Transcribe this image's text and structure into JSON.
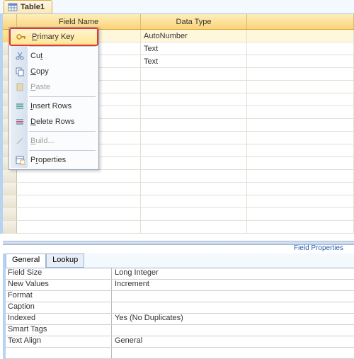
{
  "tab": {
    "label": "Table1"
  },
  "columns": {
    "fieldname": "Field Name",
    "datatype": "Data Type"
  },
  "rows": [
    {
      "datatype": "AutoNumber"
    },
    {
      "datatype": "Text"
    },
    {
      "datatype": "Text"
    }
  ],
  "menu": {
    "primary_key": "Primary Key",
    "cut": "Cut",
    "copy": "Copy",
    "paste": "Paste",
    "insert_rows": "Insert Rows",
    "delete_rows": "Delete Rows",
    "build": "Build...",
    "properties": "Properties"
  },
  "field_properties_label": "Field Properties",
  "props_tabs": {
    "general": "General",
    "lookup": "Lookup"
  },
  "properties": [
    {
      "name": "Field Size",
      "value": "Long Integer"
    },
    {
      "name": "New Values",
      "value": "Increment"
    },
    {
      "name": "Format",
      "value": ""
    },
    {
      "name": "Caption",
      "value": ""
    },
    {
      "name": "Indexed",
      "value": "Yes (No Duplicates)"
    },
    {
      "name": "Smart Tags",
      "value": ""
    },
    {
      "name": "Text Align",
      "value": "General"
    }
  ]
}
